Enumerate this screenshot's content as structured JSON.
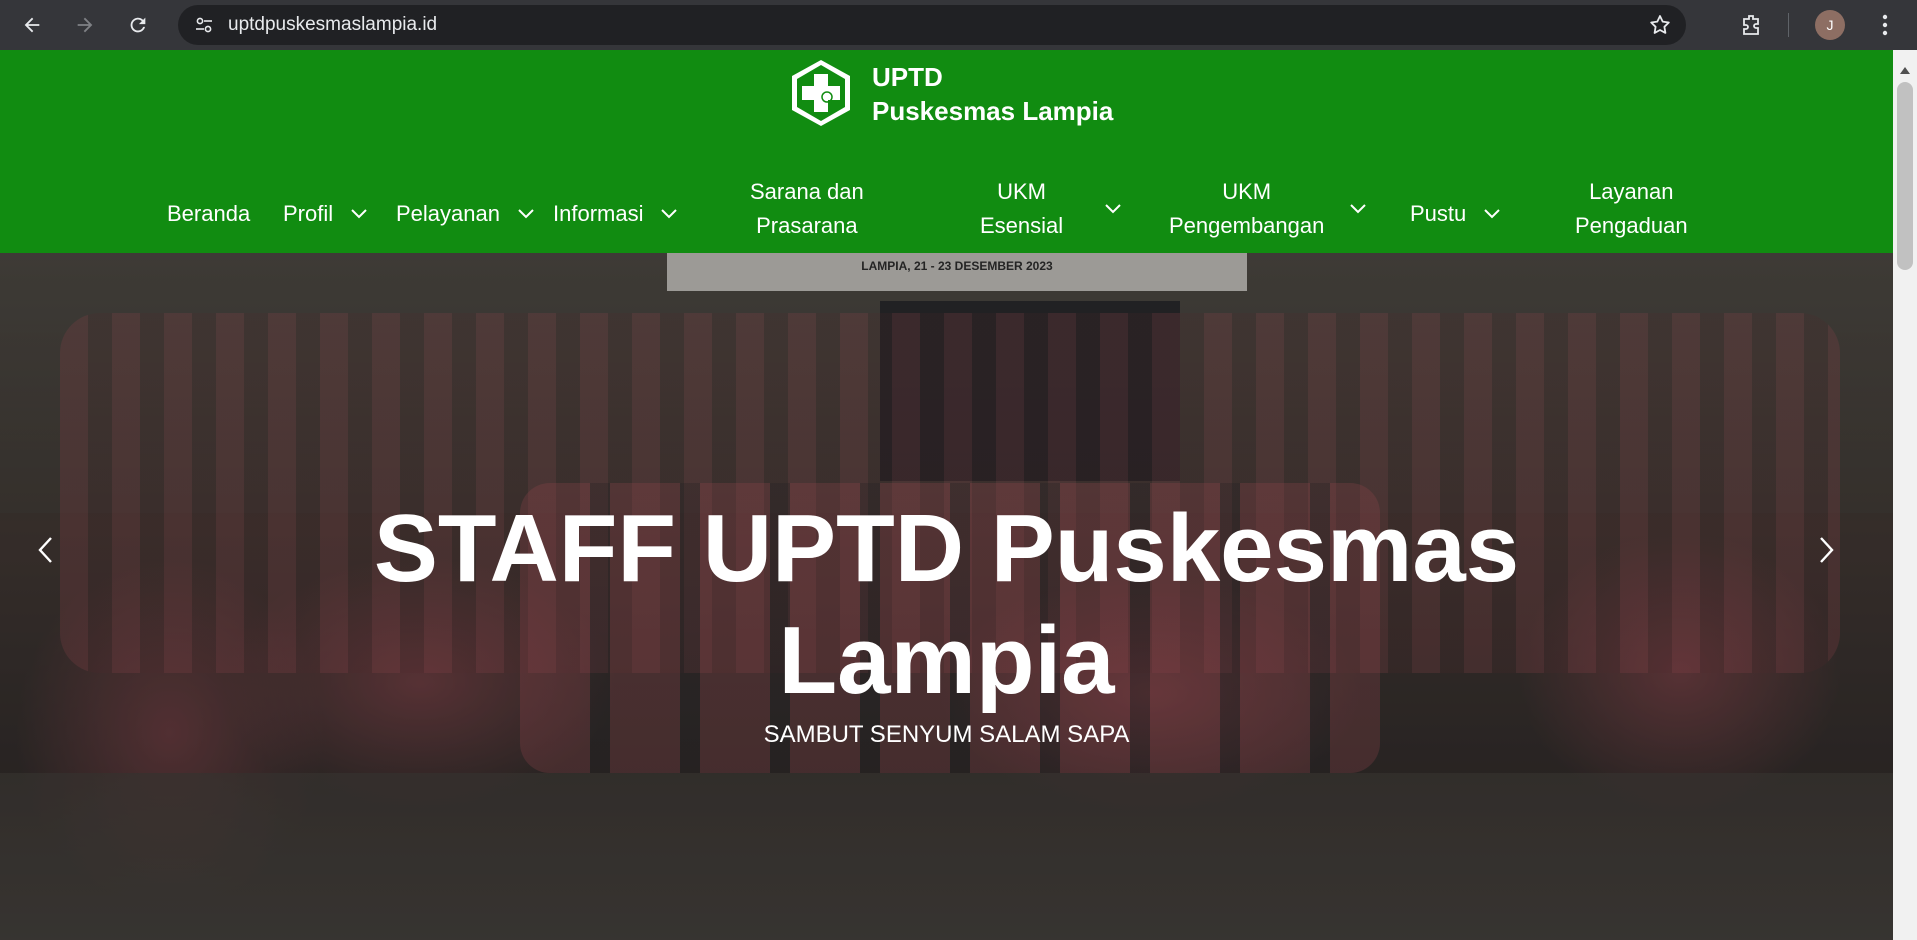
{
  "browser": {
    "url": "uptdpuskesmaslampia.id",
    "profile_initial": "J"
  },
  "site": {
    "brand_line1": "UPTD",
    "brand_line2": "Puskesmas Lampia",
    "logo_icon": "health-cross-logo",
    "accent_color": "#118c11"
  },
  "nav": {
    "items": [
      {
        "label": "Beranda",
        "has_dropdown": false
      },
      {
        "label": "Profil",
        "has_dropdown": true
      },
      {
        "label": "Pelayanan",
        "has_dropdown": true
      },
      {
        "label": "Informasi",
        "has_dropdown": true
      },
      {
        "label_line1": "Sarana dan",
        "label_line2": "Prasarana",
        "has_dropdown": false
      },
      {
        "label_line1": "UKM",
        "label_line2": "Esensial",
        "has_dropdown": true
      },
      {
        "label_line1": "UKM",
        "label_line2": "Pengembangan",
        "has_dropdown": true
      },
      {
        "label": "Pustu",
        "has_dropdown": true
      },
      {
        "label_line1": "Layanan",
        "label_line2": "Pengaduan",
        "has_dropdown": false
      }
    ]
  },
  "hero": {
    "title_line1": "STAFF UPTD Puskesmas",
    "title_line2": "Lampia",
    "subtitle": "SAMBUT SENYUM SALAM SAPA",
    "banner_text": "LAMPIA, 21 - 23 DESEMBER 2023"
  }
}
